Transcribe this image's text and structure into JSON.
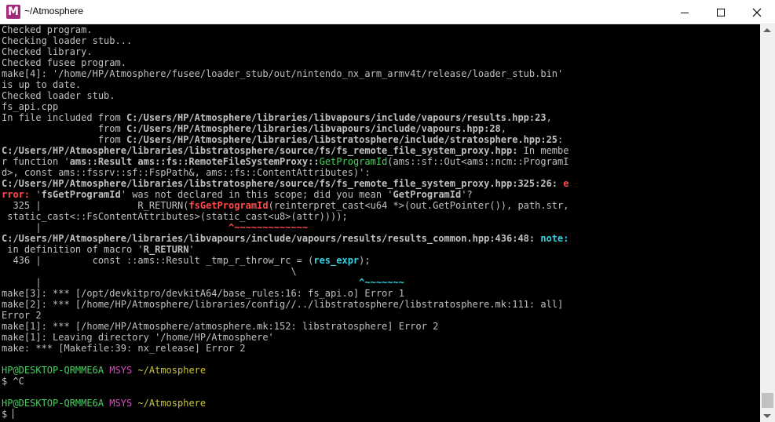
{
  "window": {
    "title": "~/Atmosphere",
    "icon_letter": "M"
  },
  "terminal": {
    "l01": "Checked program.",
    "l02": "Checking loader stub...",
    "l03": "Checked library.",
    "l04": "Checked fusee program.",
    "l05": "make[4]: '/home/HP/Atmosphere/fusee/loader_stub/out/nintendo_nx_arm_armv4t/release/loader_stub.bin'",
    "l06": "is up to date.",
    "l07": "Checked loader stub.",
    "l08": "fs_api.cpp",
    "l09a": "In file included from ",
    "l09b": "C:/Users/HP/Atmosphere/libraries/libvapours/include/vapours/results.hpp:23",
    "l09c": ",",
    "l10a": "                 from ",
    "l10b": "C:/Users/HP/Atmosphere/libraries/libvapours/include/vapours.hpp:28",
    "l10c": ",",
    "l11a": "                 from ",
    "l11b": "C:/Users/HP/Atmosphere/libraries/libstratosphere/include/stratosphere.hpp:25",
    "l11c": ":",
    "l12a": "C:/Users/HP/Atmosphere/libraries/libstratosphere/source/fs/fs_remote_file_system_proxy.hpp:",
    "l12b": " In membe",
    "l13a": "r function '",
    "l13b": "ams::Result ams::fs::RemoteFileSystemProxy::",
    "l13c": "GetProgramId",
    "l13d": "(ams::sf::Out<ams::ncm::ProgramI",
    "l14a": "d>, const ams::fssrv::sf::FspPath&, ams::fs::ContentAttributes)",
    "l14b": "':",
    "l15a": "C:/Users/HP/Atmosphere/libraries/libstratosphere/source/fs/fs_remote_file_system_proxy.hpp:325:26:",
    "l15b": " e",
    "l16a": "rror: ",
    "l16b": "'",
    "l16c": "fsGetProgramId",
    "l16d": "' was not declared in this scope; did you mean '",
    "l16e": "GetProgramId",
    "l16f": "'?",
    "l17a": "  325 |                 R_RETURN(",
    "l17b": "fsGetProgramId",
    "l17c": "(reinterpret_cast<u64 *>(out.GetPointer()), path.str,",
    "l18": " static_cast<::FsContentAttributes>(static_cast<u8>(attr))));",
    "l19a": "      |                                 ",
    "l19b": "^~~~~~~~~~~~~~",
    "l20a": "C:/Users/HP/Atmosphere/libraries/libvapours/include/vapours/results/results_common.hpp:436:48:",
    "l20b": " note:",
    "l21a": " in definition of macro '",
    "l21b": "R_RETURN",
    "l21c": "'",
    "l22a": "  436 |         const ::ams::Result _tmp_r_throw_rc = (",
    "l22b": "res_expr",
    "l22c": ");",
    "l23": "                                                   \\",
    "l24a": "      |                                                        ",
    "l24b": "^~~~~~~~",
    "l25": "make[3]: *** [/opt/devkitpro/devkitA64/base_rules:16: fs_api.o] Error 1",
    "l26": "make[2]: *** [/home/HP/Atmosphere/libraries/config//../libstratosphere/libstratosphere.mk:111: all]",
    "l27": "Error 2",
    "l28": "make[1]: *** [/home/HP/Atmosphere/atmosphere.mk:152: libstratosphere] Error 2",
    "l29": "make[1]: Leaving directory '/home/HP/Atmosphere'",
    "l30": "make: *** [Makefile:39: nx_release] Error 2",
    "prompt1_user": "HP@DESKTOP-QRMME6A",
    "prompt1_env": "MSYS",
    "prompt1_dir": "~/Atmosphere",
    "cmd1": "$ ^C",
    "prompt2_user": "HP@DESKTOP-QRMME6A",
    "prompt2_env": "MSYS",
    "prompt2_dir": "~/Atmosphere",
    "cmd2": "$ "
  },
  "colors": {
    "text": "#c0c0c0",
    "green": "#46d160",
    "magenta": "#d44fbf",
    "yellow": "#c7c43b",
    "red": "#ff4a4a",
    "cyan": "#32d0e0",
    "teal": "#3aa3d6"
  }
}
